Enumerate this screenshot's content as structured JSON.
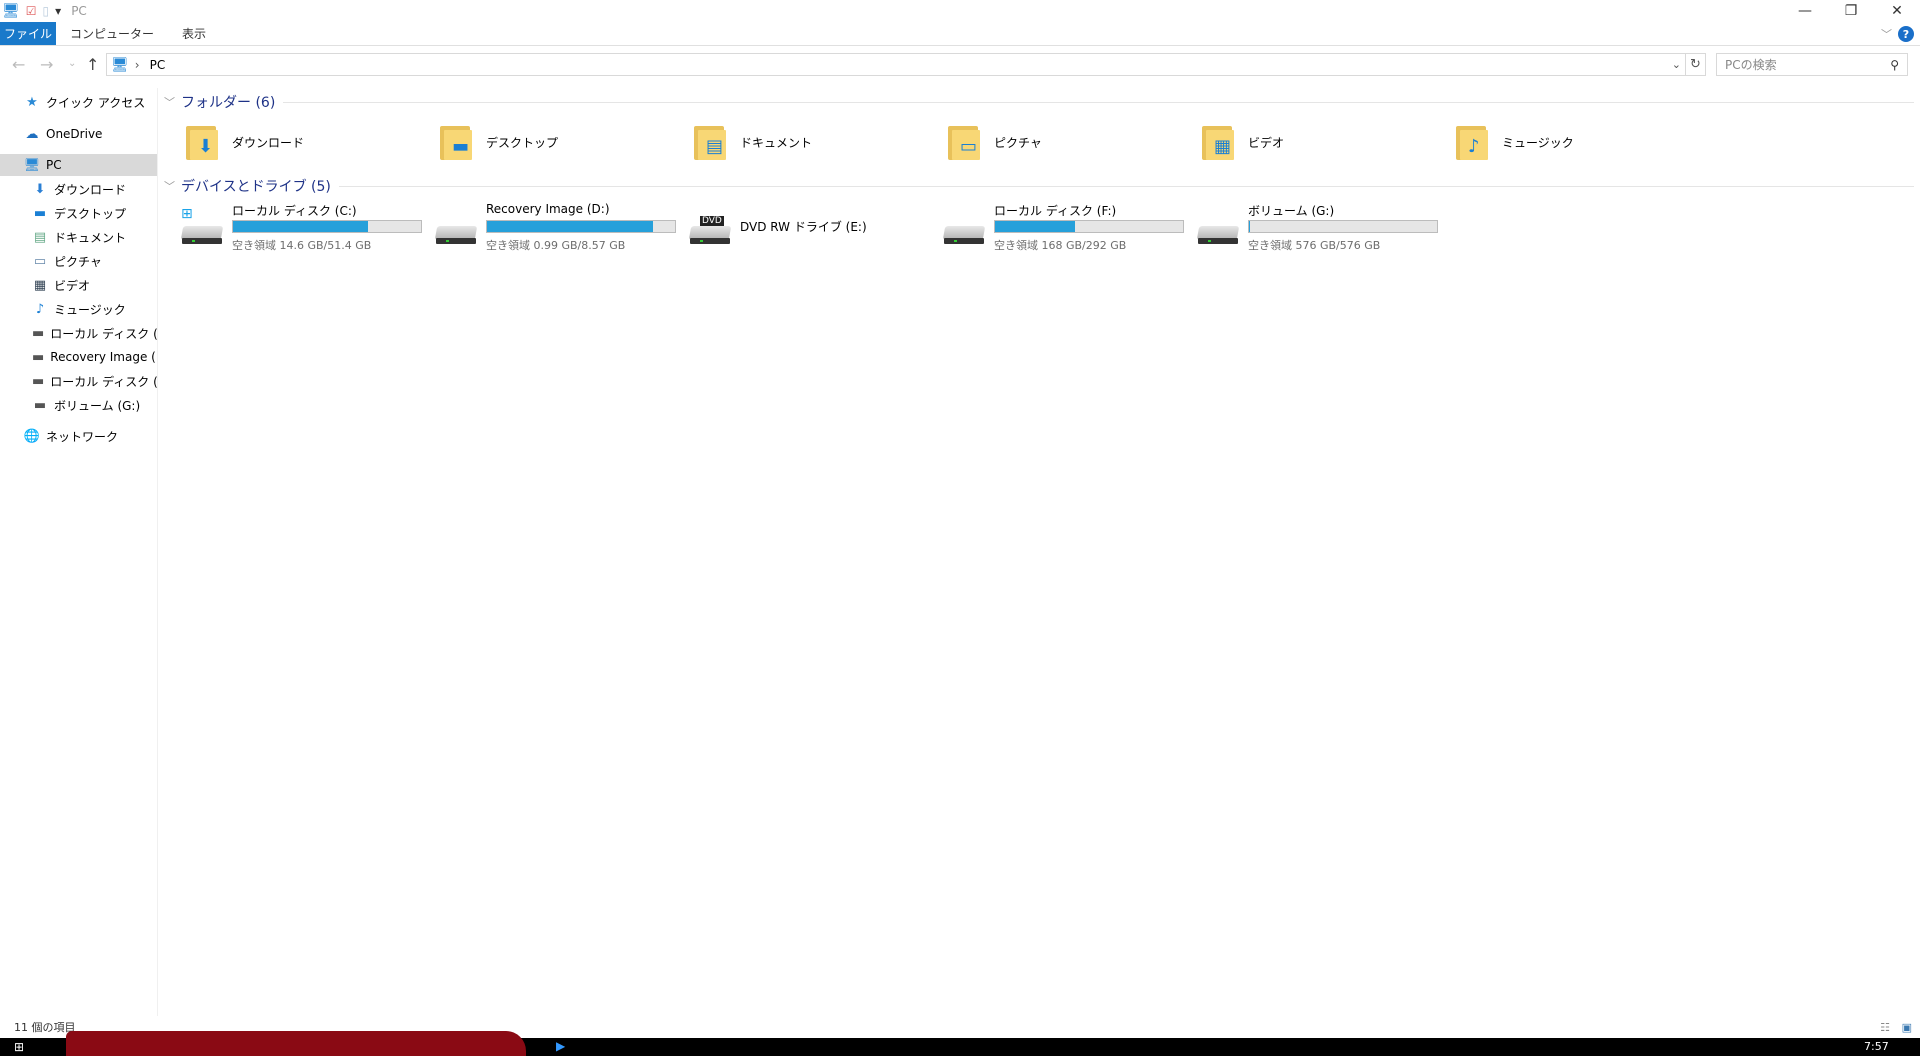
{
  "title": "PC",
  "window": {
    "minimize": "—",
    "restore": "❐",
    "close": "✕"
  },
  "ribbon": {
    "tabs": [
      "ファイル",
      "コンピューター",
      "表示"
    ],
    "help": "?"
  },
  "address": {
    "path_root": "PC",
    "separator": "›"
  },
  "search": {
    "placeholder": "PCの検索"
  },
  "sidebar": {
    "items": [
      {
        "label": "クイック アクセス",
        "icon": "star-icon"
      },
      {
        "label": "OneDrive",
        "icon": "cloud-icon"
      },
      {
        "label": "PC",
        "icon": "computer-icon",
        "selected": true
      },
      {
        "label": "ダウンロード",
        "icon": "download-icon"
      },
      {
        "label": "デスクトップ",
        "icon": "desktop-icon"
      },
      {
        "label": "ドキュメント",
        "icon": "document-icon"
      },
      {
        "label": "ピクチャ",
        "icon": "picture-icon"
      },
      {
        "label": "ビデオ",
        "icon": "video-icon"
      },
      {
        "label": "ミュージック",
        "icon": "music-icon"
      },
      {
        "label": "ローカル ディスク (C:)",
        "icon": "drive-icon"
      },
      {
        "label": "Recovery Image (D:)",
        "icon": "drive-icon"
      },
      {
        "label": "ローカル ディスク (F:)",
        "icon": "drive-icon"
      },
      {
        "label": "ボリューム (G:)",
        "icon": "drive-icon"
      },
      {
        "label": "ネットワーク",
        "icon": "network-icon"
      }
    ]
  },
  "folders": {
    "header": "フォルダー (6)",
    "items": [
      {
        "label": "ダウンロード",
        "overlay": "⬇"
      },
      {
        "label": "デスクトップ",
        "overlay": "▬"
      },
      {
        "label": "ドキュメント",
        "overlay": "▤"
      },
      {
        "label": "ピクチャ",
        "overlay": "▭"
      },
      {
        "label": "ビデオ",
        "overlay": "▦"
      },
      {
        "label": "ミュージック",
        "overlay": "♪"
      }
    ]
  },
  "drives": {
    "header": "デバイスとドライブ (5)",
    "items": [
      {
        "name": "ローカル ディスク (C:)",
        "free": "空き領域 14.6 GB/51.4 GB",
        "used_pct": 71.6,
        "bar": true
      },
      {
        "name": "Recovery Image (D:)",
        "free": "空き領域 0.99 GB/8.57 GB",
        "used_pct": 88.4,
        "bar": true
      },
      {
        "name": "DVD RW ドライブ (E:)",
        "free": "",
        "used_pct": 0,
        "bar": false,
        "badge": "DVD"
      },
      {
        "name": "ローカル ディスク (F:)",
        "free": "空き領域 168 GB/292 GB",
        "used_pct": 42.5,
        "bar": true
      },
      {
        "name": "ボリューム (G:)",
        "free": "空き領域 576 GB/576 GB",
        "used_pct": 0.1,
        "bar": true
      }
    ]
  },
  "status": {
    "count": "11 個の項目"
  },
  "taskbar": {
    "clock": "7:57"
  },
  "colors": {
    "accent": "#1979ca",
    "bar": "#26a0da",
    "header": "#1e3287"
  }
}
